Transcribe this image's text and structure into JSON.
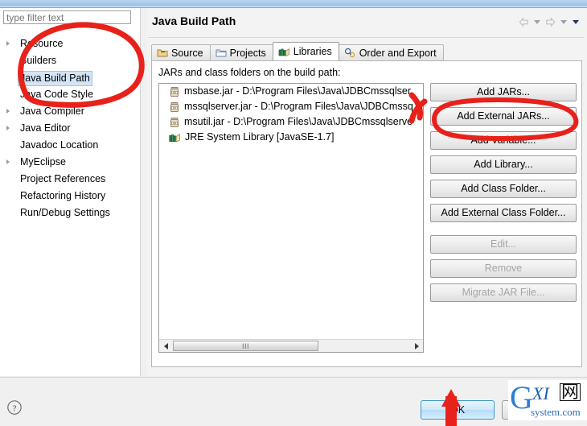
{
  "window": {
    "title": "Java Build Path"
  },
  "sidebar": {
    "filter_placeholder": "type filter text",
    "filter_value": "",
    "items": [
      {
        "label": "Resource",
        "expandable": true,
        "selected": false
      },
      {
        "label": "Builders",
        "expandable": false,
        "selected": false
      },
      {
        "label": "Java Build Path",
        "expandable": false,
        "selected": true
      },
      {
        "label": "Java Code Style",
        "expandable": false,
        "selected": false
      },
      {
        "label": "Java Compiler",
        "expandable": true,
        "selected": false
      },
      {
        "label": "Java Editor",
        "expandable": true,
        "selected": false
      },
      {
        "label": "Javadoc Location",
        "expandable": false,
        "selected": false
      },
      {
        "label": "MyEclipse",
        "expandable": true,
        "selected": false
      },
      {
        "label": "Project References",
        "expandable": false,
        "selected": false
      },
      {
        "label": "Refactoring History",
        "expandable": false,
        "selected": false
      },
      {
        "label": "Run/Debug Settings",
        "expandable": false,
        "selected": false
      }
    ]
  },
  "nav": {
    "back_icon": "back-arrow-icon",
    "back_menu_icon": "chevron-down-icon",
    "forward_icon": "forward-arrow-icon",
    "forward_menu_icon": "chevron-down-icon",
    "menu_icon": "chevron-down-icon"
  },
  "tabs": [
    {
      "label": "Source",
      "icon": "source-folder-icon",
      "active": false
    },
    {
      "label": "Projects",
      "icon": "projects-folder-icon",
      "active": false
    },
    {
      "label": "Libraries",
      "icon": "libraries-books-icon",
      "active": true
    },
    {
      "label": "Order and Export",
      "icon": "order-export-icon",
      "active": false
    }
  ],
  "libraries_panel": {
    "label": "JARs and class folders on the build path:",
    "entries": [
      {
        "icon": "jar-icon",
        "text": "msbase.jar - D:\\Program Files\\Java\\JDBCmssqlser"
      },
      {
        "icon": "jar-icon",
        "text": "mssqlserver.jar - D:\\Program Files\\Java\\JDBCmssq"
      },
      {
        "icon": "jar-icon",
        "text": "msutil.jar - D:\\Program Files\\Java\\JDBCmssqlserve"
      },
      {
        "icon": "jre-library-icon",
        "text": "JRE System Library [JavaSE-1.7]"
      }
    ],
    "scrollbar": {
      "left_arrow": "scroll-left-arrow-icon",
      "right_arrow": "scroll-right-arrow-icon",
      "grip": "III"
    },
    "buttons": [
      {
        "label": "Add JARs...",
        "enabled": true
      },
      {
        "label": "Add External JARs...",
        "enabled": true
      },
      {
        "label": "Add Variable...",
        "enabled": true
      },
      {
        "label": "Add Library...",
        "enabled": true
      },
      {
        "label": "Add Class Folder...",
        "enabled": true
      },
      {
        "label": "Add External Class Folder...",
        "enabled": true
      },
      {
        "label": "Edit...",
        "enabled": false
      },
      {
        "label": "Remove",
        "enabled": false
      },
      {
        "label": "Migrate JAR File...",
        "enabled": false
      }
    ]
  },
  "footer": {
    "help_icon": "help-question-icon",
    "ok_label": "OK"
  },
  "watermark": {
    "letter": "G",
    "middle": "XI",
    "cn": "网",
    "sub": "system.com"
  },
  "annotations": {
    "color": "#e8211a",
    "marks": [
      "ellipse-around-sidebar-items",
      "ellipse-around-add-external-jars-button",
      "arrow-pointing-to-ok-button"
    ]
  },
  "colors": {
    "accent": "#e8211a",
    "selection": "#d3e5f5",
    "titlebar": "#a9caea",
    "watermark_blue": "#2a7fd4"
  }
}
